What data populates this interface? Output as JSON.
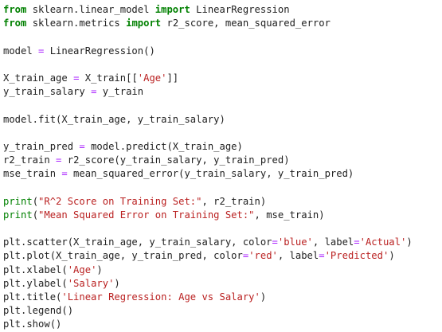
{
  "colors": {
    "keyword": "#008000",
    "string": "#ba2121",
    "operator": "#aa22ff",
    "text": "#212121",
    "background": "#ffffff"
  },
  "code": {
    "lines": [
      [
        {
          "t": "kw",
          "v": "from"
        },
        {
          "t": "pl",
          "v": " sklearn.linear_model "
        },
        {
          "t": "kw",
          "v": "import"
        },
        {
          "t": "pl",
          "v": " LinearRegression"
        }
      ],
      [
        {
          "t": "kw",
          "v": "from"
        },
        {
          "t": "pl",
          "v": " sklearn.metrics "
        },
        {
          "t": "kw",
          "v": "import"
        },
        {
          "t": "pl",
          "v": " r2_score, mean_squared_error"
        }
      ],
      [],
      [
        {
          "t": "pl",
          "v": "model "
        },
        {
          "t": "op",
          "v": "="
        },
        {
          "t": "pl",
          "v": " LinearRegression()"
        }
      ],
      [],
      [
        {
          "t": "pl",
          "v": "X_train_age "
        },
        {
          "t": "op",
          "v": "="
        },
        {
          "t": "pl",
          "v": " X_train[["
        },
        {
          "t": "str",
          "v": "'Age'"
        },
        {
          "t": "pl",
          "v": "]]"
        }
      ],
      [
        {
          "t": "pl",
          "v": "y_train_salary "
        },
        {
          "t": "op",
          "v": "="
        },
        {
          "t": "pl",
          "v": " y_train"
        }
      ],
      [],
      [
        {
          "t": "pl",
          "v": "model.fit(X_train_age, y_train_salary)"
        }
      ],
      [],
      [
        {
          "t": "pl",
          "v": "y_train_pred "
        },
        {
          "t": "op",
          "v": "="
        },
        {
          "t": "pl",
          "v": " model.predict(X_train_age)"
        }
      ],
      [
        {
          "t": "pl",
          "v": "r2_train "
        },
        {
          "t": "op",
          "v": "="
        },
        {
          "t": "pl",
          "v": " r2_score(y_train_salary, y_train_pred)"
        }
      ],
      [
        {
          "t": "pl",
          "v": "mse_train "
        },
        {
          "t": "op",
          "v": "="
        },
        {
          "t": "pl",
          "v": " mean_squared_error(y_train_salary, y_train_pred)"
        }
      ],
      [],
      [
        {
          "t": "bi",
          "v": "print"
        },
        {
          "t": "pl",
          "v": "("
        },
        {
          "t": "str",
          "v": "\"R^2 Score on Training Set:\""
        },
        {
          "t": "pl",
          "v": ", r2_train)"
        }
      ],
      [
        {
          "t": "bi",
          "v": "print"
        },
        {
          "t": "pl",
          "v": "("
        },
        {
          "t": "str",
          "v": "\"Mean Squared Error on Training Set:\""
        },
        {
          "t": "pl",
          "v": ", mse_train)"
        }
      ],
      [],
      [
        {
          "t": "pl",
          "v": "plt.scatter(X_train_age, y_train_salary, color"
        },
        {
          "t": "op",
          "v": "="
        },
        {
          "t": "str",
          "v": "'blue'"
        },
        {
          "t": "pl",
          "v": ", label"
        },
        {
          "t": "op",
          "v": "="
        },
        {
          "t": "str",
          "v": "'Actual'"
        },
        {
          "t": "pl",
          "v": ")"
        }
      ],
      [
        {
          "t": "pl",
          "v": "plt.plot(X_train_age, y_train_pred, color"
        },
        {
          "t": "op",
          "v": "="
        },
        {
          "t": "str",
          "v": "'red'"
        },
        {
          "t": "pl",
          "v": ", label"
        },
        {
          "t": "op",
          "v": "="
        },
        {
          "t": "str",
          "v": "'Predicted'"
        },
        {
          "t": "pl",
          "v": ")"
        }
      ],
      [
        {
          "t": "pl",
          "v": "plt.xlabel("
        },
        {
          "t": "str",
          "v": "'Age'"
        },
        {
          "t": "pl",
          "v": ")"
        }
      ],
      [
        {
          "t": "pl",
          "v": "plt.ylabel("
        },
        {
          "t": "str",
          "v": "'Salary'"
        },
        {
          "t": "pl",
          "v": ")"
        }
      ],
      [
        {
          "t": "pl",
          "v": "plt.title("
        },
        {
          "t": "str",
          "v": "'Linear Regression: Age vs Salary'"
        },
        {
          "t": "pl",
          "v": ")"
        }
      ],
      [
        {
          "t": "pl",
          "v": "plt.legend()"
        }
      ],
      [
        {
          "t": "pl",
          "v": "plt.show()"
        }
      ]
    ]
  }
}
